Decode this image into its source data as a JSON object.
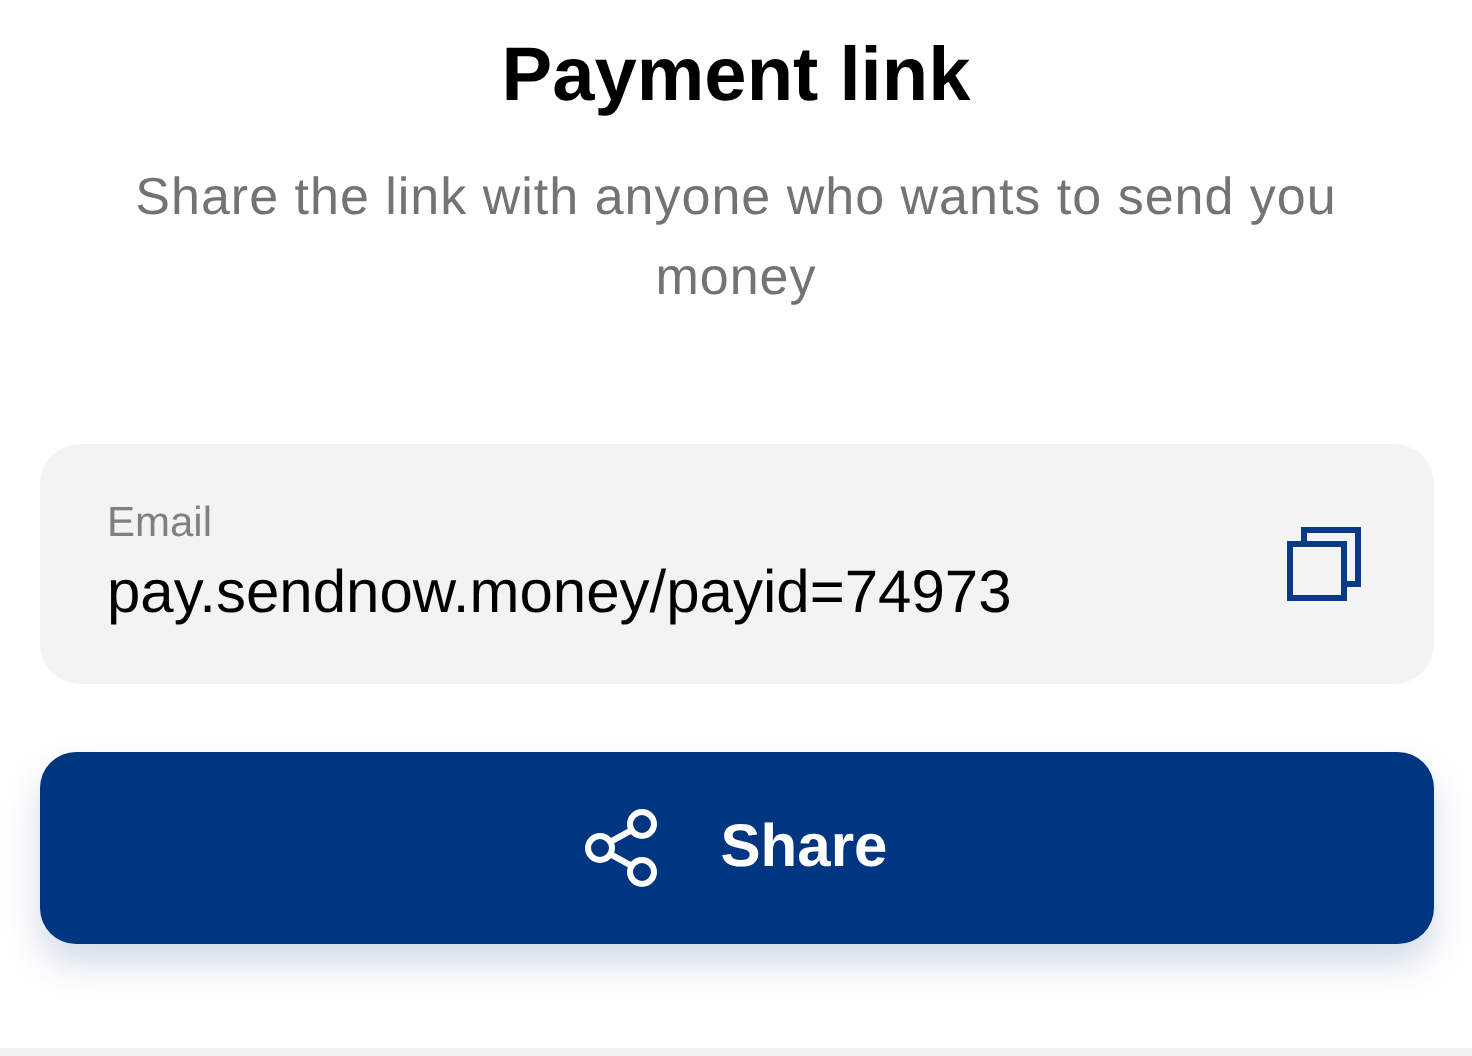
{
  "title": "Payment link",
  "subtitle": "Share the link with anyone who wants to send you money",
  "link_field": {
    "label": "Email",
    "value": "pay.sendnow.money/payid=74973"
  },
  "share_button": {
    "label": "Share"
  }
}
